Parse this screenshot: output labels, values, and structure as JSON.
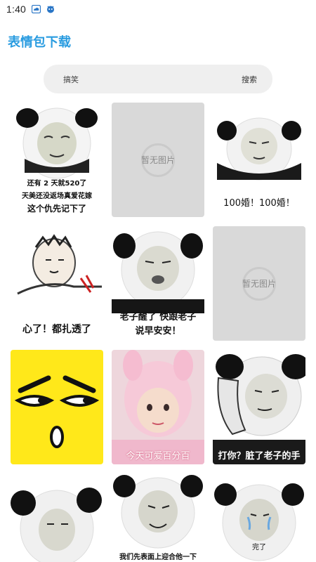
{
  "status": {
    "time": "1:40",
    "icons": [
      "cloud-app-icon",
      "shield-app-icon"
    ]
  },
  "app": {
    "title": "表情包下载"
  },
  "search": {
    "value": "搞笑",
    "button_label": "搜索"
  },
  "grid": {
    "placeholder_text": "暂无图片",
    "items": [
      {
        "kind": "image",
        "caption_lines": [
          "还有 2 天就520了",
          "天美还没返场真爱花嫁",
          "这个仇先记下了"
        ]
      },
      {
        "kind": "placeholder"
      },
      {
        "kind": "image",
        "caption_lines": [
          "100婚！100婚！"
        ]
      },
      {
        "kind": "image",
        "caption_lines": [
          "心了！都扎透了"
        ]
      },
      {
        "kind": "image",
        "caption_lines": [
          "老子醒了 快跟老子",
          "说早安安！"
        ]
      },
      {
        "kind": "placeholder"
      },
      {
        "kind": "image",
        "caption_lines": []
      },
      {
        "kind": "image",
        "caption_lines": [
          "今天可爱百分百"
        ]
      },
      {
        "kind": "image",
        "caption_lines": [
          "打你？脏了老子的手"
        ]
      },
      {
        "kind": "image",
        "caption_lines": []
      },
      {
        "kind": "image",
        "caption_lines": [
          "我们先表面上迎合他一下"
        ]
      },
      {
        "kind": "image",
        "caption_lines": [
          "完了"
        ]
      }
    ]
  }
}
